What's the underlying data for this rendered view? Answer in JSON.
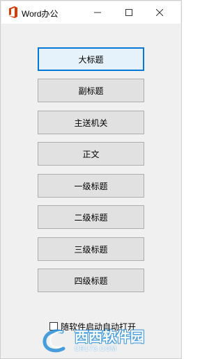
{
  "window": {
    "title": "Word办公",
    "minimize_glyph": "—",
    "maximize_glyph": "☐",
    "close_glyph": "✕",
    "icon": "office-icon"
  },
  "buttons": [
    {
      "label": "大标题",
      "focused": true
    },
    {
      "label": "副标题",
      "focused": false
    },
    {
      "label": "主送机关",
      "focused": false
    },
    {
      "label": "正文",
      "focused": false
    },
    {
      "label": "一级标题",
      "focused": false
    },
    {
      "label": "二级标题",
      "focused": false
    },
    {
      "label": "三级标题",
      "focused": false
    },
    {
      "label": "四级标题",
      "focused": false
    }
  ],
  "startup_checkbox": {
    "label": "随软件启动自动打开",
    "checked": false
  },
  "watermark": {
    "main": "西西软件园",
    "sub": "CR173.COM"
  },
  "colors": {
    "accent": "#0078d7",
    "office_icon": "#d83b01",
    "watermark": "#2a8fd8"
  }
}
